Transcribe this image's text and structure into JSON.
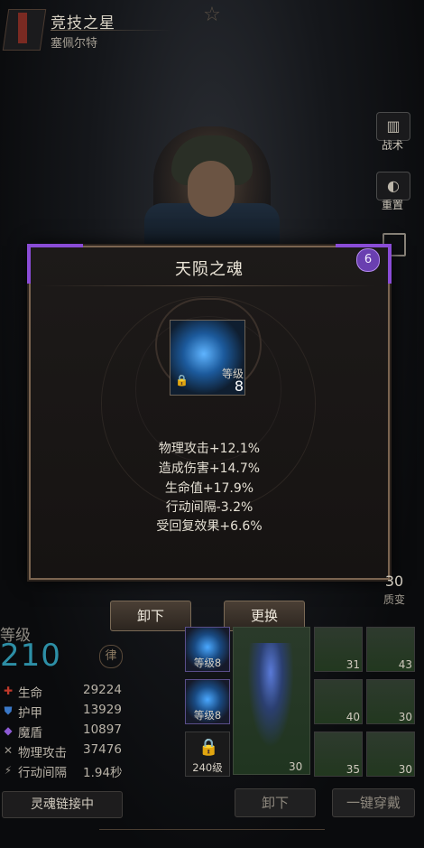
{
  "header": {
    "title": "竞技之星",
    "subtitle": "塞佩尔特"
  },
  "side_buttons": [
    {
      "label": "战术",
      "icon": "tactics-icon"
    },
    {
      "label": "重置",
      "icon": "reset-icon"
    }
  ],
  "dialog": {
    "title": "天陨之魂",
    "badge": "6",
    "item": {
      "level_label": "等级",
      "level": "8",
      "locked": true
    },
    "stats": [
      "物理攻击+12.1%",
      "造成伤害+14.7%",
      "生命值+17.9%",
      "行动间隔-3.2%",
      "受回复效果+6.6%"
    ]
  },
  "actions": {
    "unequip": "卸下",
    "replace": "更换"
  },
  "quality": {
    "value": "30",
    "label": "质变"
  },
  "level": {
    "label": "等级",
    "value": "210"
  },
  "stats_panel": [
    {
      "name": "生命",
      "value": "29224",
      "icon": "heart-icon",
      "color": "#c0392b"
    },
    {
      "name": "护甲",
      "value": "13929",
      "icon": "shield-icon",
      "color": "#3a78c8"
    },
    {
      "name": "魔盾",
      "value": "10897",
      "icon": "magic-shield-icon",
      "color": "#8e5bd6"
    },
    {
      "name": "物理攻击",
      "value": "37476",
      "icon": "sword-icon",
      "color": "#b9b3a8"
    },
    {
      "name": "行动间隔",
      "value": "1.94秒",
      "icon": "speed-icon",
      "color": "#b9b3a8"
    }
  ],
  "soul_link": "灵魂链接中",
  "soul_slots": [
    {
      "label": "等级8"
    },
    {
      "label": "等级8"
    },
    {
      "label": "240级"
    }
  ],
  "weapon": {
    "count": "30"
  },
  "equipment": [
    {
      "count": "31"
    },
    {
      "count": "43"
    },
    {
      "count": "40"
    },
    {
      "count": "30"
    },
    {
      "count": "35"
    },
    {
      "count": "30"
    }
  ],
  "bottom_actions": {
    "unequip": "卸下",
    "equip_all": "一键穿戴"
  }
}
